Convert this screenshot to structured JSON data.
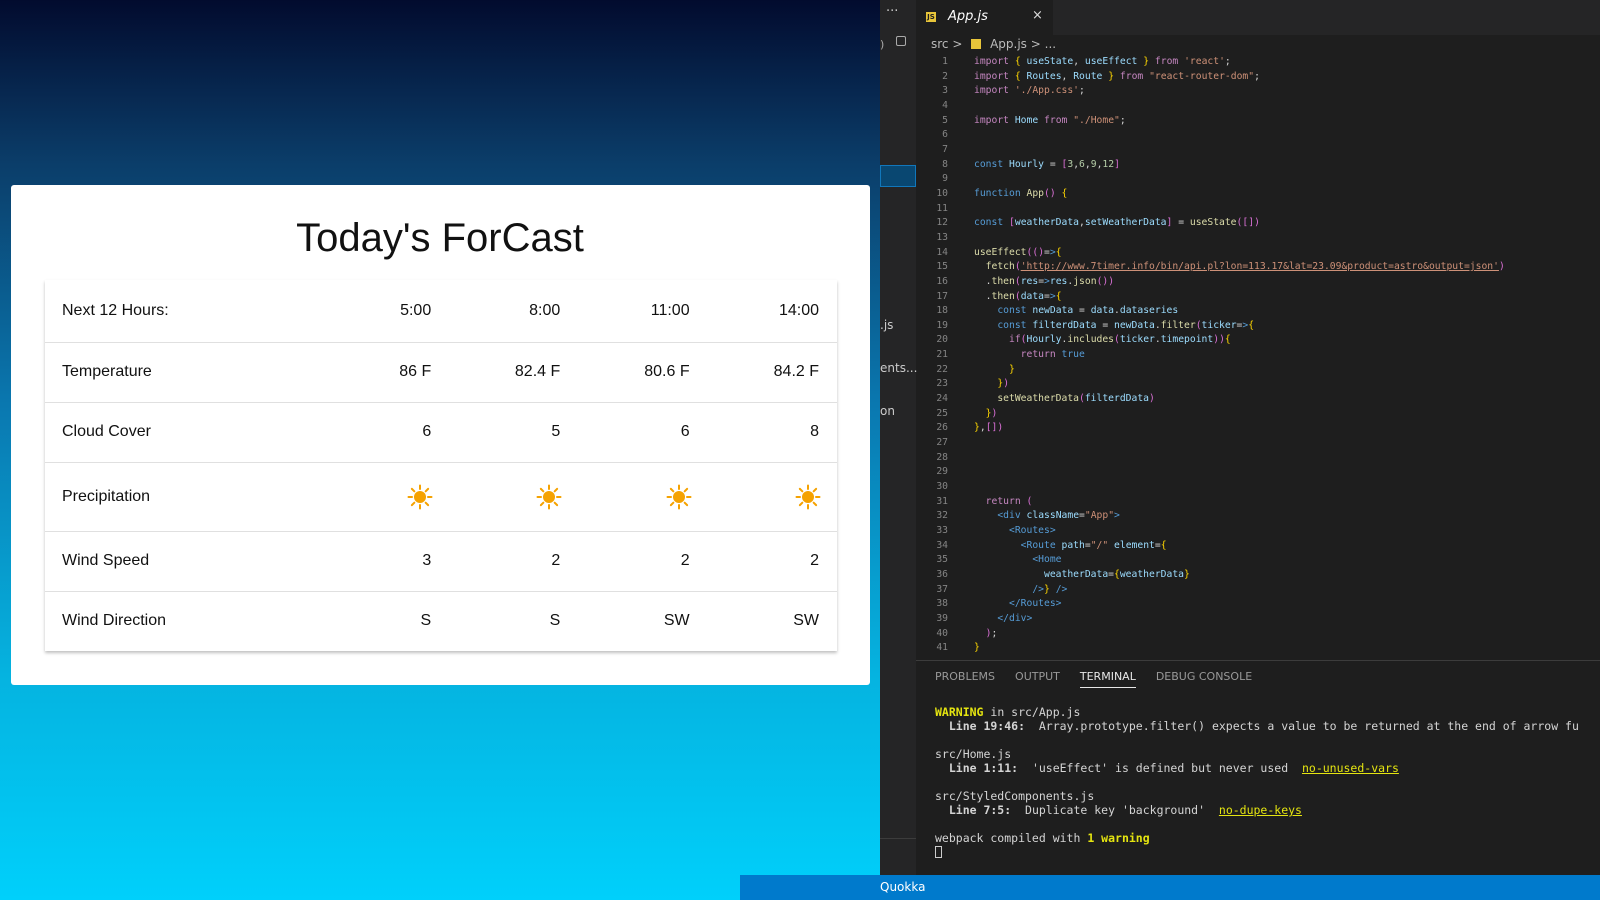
{
  "forecast": {
    "title": "Today's ForCast",
    "header": {
      "label": "Next 12 Hours:",
      "times": [
        "5:00",
        "8:00",
        "11:00",
        "14:00"
      ]
    },
    "rows": [
      {
        "label": "Temperature",
        "values": [
          "86 F",
          "82.4 F",
          "80.6 F",
          "84.2 F"
        ]
      },
      {
        "label": "Cloud Cover",
        "values": [
          "6",
          "5",
          "6",
          "8"
        ]
      },
      {
        "label": "Precipitation",
        "icon": "sun-icon"
      },
      {
        "label": "Wind Speed",
        "values": [
          "3",
          "2",
          "2",
          "2"
        ]
      },
      {
        "label": "Wind Direction",
        "values": [
          "S",
          "S",
          "SW",
          "SW"
        ]
      }
    ]
  },
  "editor": {
    "activity_dots": "···",
    "sidebar_fragments": [
      ".js",
      "ents...",
      "on"
    ],
    "tab": {
      "label": "App.js",
      "close": "×"
    },
    "breadcrumb": {
      "folder": "src",
      "sep": ">",
      "file": "App.js",
      "more": "..."
    },
    "code_lines": [
      "import { useState, useEffect } from 'react';",
      "import { Routes, Route } from \"react-router-dom\";",
      "import './App.css';",
      "",
      "import Home from \"./Home\";",
      "",
      "",
      "const Hourly = [3,6,9,12]",
      "",
      "function App() {",
      "",
      "const [weatherData,setWeatherData] = useState([])",
      "",
      "useEffect(()=>{",
      "  fetch('http://www.7timer.info/bin/api.pl?lon=113.17&lat=23.09&product=astro&output=json')",
      "  .then(res=>res.json())",
      "  .then(data=>{",
      "    const newData = data.dataseries",
      "    const filterdData = newData.filter(ticker=>{",
      "      if(Hourly.includes(ticker.timepoint)){",
      "        return true",
      "      }",
      "    })",
      "    setWeatherData(filterdData)",
      "  })",
      "},[])",
      "",
      "",
      "",
      "",
      "  return (",
      "    <div className=\"App\">",
      "      <Routes>",
      "        <Route path=\"/\" element={",
      "          <Home",
      "            weatherData={weatherData}",
      "          />} />",
      "      </Routes>",
      "    </div>",
      "  );",
      "}"
    ],
    "panel_tabs": [
      "PROBLEMS",
      "OUTPUT",
      "TERMINAL",
      "DEBUG CONSOLE"
    ],
    "panel_active": "TERMINAL",
    "terminal": {
      "warning_word": "WARNING",
      "warning_file": " in src/App.js",
      "w1_loc": "  Line 19:46:",
      "w1_msg": "  Array.prototype.filter() expects a value to be returned at the end of arrow fu",
      "f2": "src/Home.js",
      "w2_loc": "  Line 1:11:",
      "w2_msg": "  'useEffect' is defined but never used  ",
      "w2_rule": "no-unused-vars",
      "f3": "src/StyledComponents.js",
      "w3_loc": "  Line 7:5:",
      "w3_msg": "  Duplicate key 'background'  ",
      "w3_rule": "no-dupe-keys",
      "compiled": "webpack compiled with ",
      "compiled_bold": "1 warning"
    },
    "status": "Quokka"
  },
  "colors": {
    "accent": "#007acc",
    "sun": "#f5a201",
    "warning": "#e5e510"
  }
}
